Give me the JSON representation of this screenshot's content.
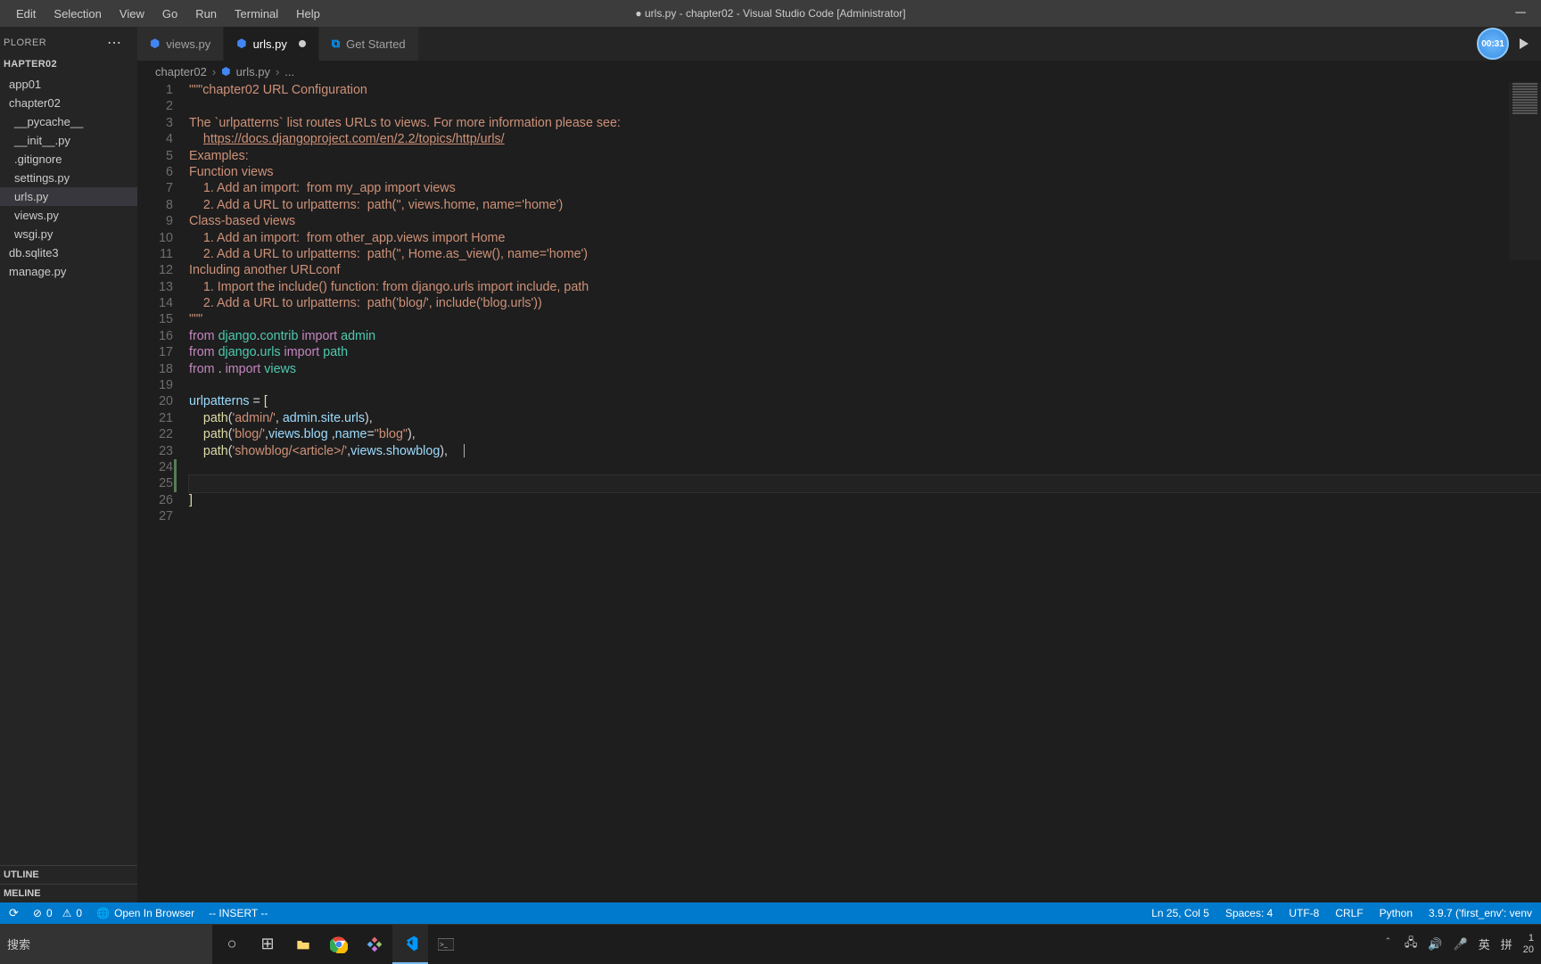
{
  "menu": [
    "Edit",
    "Selection",
    "View",
    "Go",
    "Run",
    "Terminal",
    "Help"
  ],
  "window_title": "● urls.py - chapter02 - Visual Studio Code [Administrator]",
  "explorer": {
    "label": "PLORER",
    "project": "HAPTER02",
    "items": [
      {
        "label": "app01",
        "indent": 0
      },
      {
        "label": "chapter02",
        "indent": 0
      },
      {
        "label": "__pycache__",
        "indent": 1
      },
      {
        "label": "__init__.py",
        "indent": 1
      },
      {
        "label": ".gitignore",
        "indent": 1
      },
      {
        "label": "settings.py",
        "indent": 1
      },
      {
        "label": "urls.py",
        "indent": 1,
        "active": true
      },
      {
        "label": "views.py",
        "indent": 1
      },
      {
        "label": "wsgi.py",
        "indent": 1
      },
      {
        "label": "db.sqlite3",
        "indent": 0
      },
      {
        "label": "manage.py",
        "indent": 0
      }
    ],
    "outline": "UTLINE",
    "timeline": "MELINE"
  },
  "tabs": [
    {
      "label": "views.py",
      "icon": "python"
    },
    {
      "label": "urls.py",
      "icon": "python",
      "active": true,
      "modified": true
    },
    {
      "label": "Get Started",
      "icon": "vscode"
    }
  ],
  "timer": "00:31",
  "breadcrumb": {
    "p1": "chapter02",
    "p2": "urls.py",
    "p3": "..."
  },
  "code_lines": 27,
  "status": {
    "errors": "0",
    "warnings": "0",
    "open_browser": "Open In Browser",
    "vim_mode": "-- INSERT --",
    "lncol": "Ln 25, Col 5",
    "spaces": "Spaces: 4",
    "encoding": "UTF-8",
    "eol": "CRLF",
    "lang": "Python",
    "env": "3.9.7 ('first_env': venv"
  },
  "taskbar": {
    "search": "搜索",
    "ime": "英",
    "tray_extra": "拼"
  }
}
